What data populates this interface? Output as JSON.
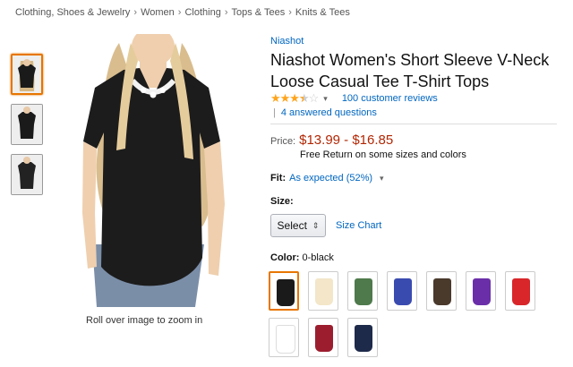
{
  "breadcrumb": [
    "Clothing, Shoes & Jewelry",
    "Women",
    "Clothing",
    "Tops & Tees",
    "Knits & Tees"
  ],
  "gallery": {
    "zoom_hint": "Roll over image to zoom in"
  },
  "product": {
    "brand": "Niashot",
    "title": "Niashot Women's Short Sleeve V-Neck Loose Casual Tee T-Shirt Tops",
    "rating": {
      "stars": 3.5,
      "reviews_text": "100 customer reviews"
    },
    "answered": "4 answered questions",
    "price_label": "Price:",
    "price": "$13.99 - $16.85",
    "free_return": "Free Return on some sizes and colors",
    "fit_label": "Fit:",
    "fit_value": "As expected (52%)",
    "size_label": "Size:",
    "size_select": "Select",
    "size_chart": "Size Chart",
    "color_label": "Color:",
    "color_value": "0-black"
  },
  "swatch_colors": [
    "#1a1a1a",
    "#f3e6c9",
    "#4f7a4c",
    "#3a4bb0",
    "#4a3a2c",
    "#6a2fa8",
    "#d8262b",
    "#ffffff",
    "#9c1d2e",
    "#1e2a4a"
  ],
  "accent_color": "#e77600",
  "link_color": "#0066c0",
  "price_color": "#b12704"
}
